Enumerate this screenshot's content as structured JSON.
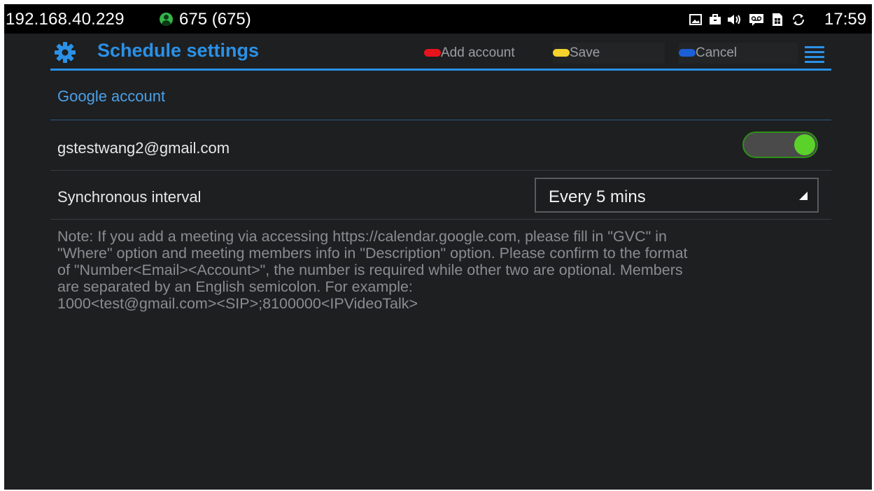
{
  "statusbar": {
    "ip": "192.168.40.229",
    "extension": "675 (675)",
    "user_icon": "contact-icon",
    "icons": [
      "image-icon",
      "briefcase-icon",
      "volume-icon",
      "voicemail-icon",
      "sim-icon",
      "sync-icon"
    ],
    "time": "17:59"
  },
  "actionbar": {
    "title": "Schedule settings",
    "add_account_label": "Add account",
    "save_label": "Save",
    "cancel_label": "Cancel",
    "add_account_color": "#e8141b",
    "save_color": "#f4d22b",
    "cancel_color": "#1b5fd6"
  },
  "content": {
    "section_header": "Google account",
    "account_email": "gstestwang2@gmail.com",
    "account_enabled": true,
    "sync_label": "Synchronous interval",
    "sync_value": "Every 5 mins",
    "note_lines": [
      "Note: If you add a meeting via accessing https://calendar.google.com, please fill in \"GVC\" in",
      "\"Where\" option and meeting members info in \"Description\" option. Please confirm to the format",
      "of \"Number<Email><Account>\", the number is required while other two are optional. Members",
      "are separated by an English semicolon. For example:",
      "1000<test@gmail.com><SIP>;8100000<IPVideoTalk>"
    ]
  },
  "colors": {
    "accent": "#2b91e6",
    "background": "#1e1f21",
    "toggle_on": "#5ad22a"
  }
}
